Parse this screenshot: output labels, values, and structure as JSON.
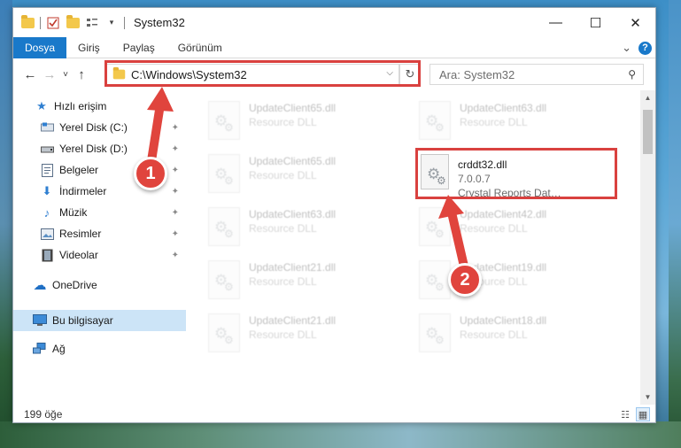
{
  "window": {
    "title": "System32",
    "controls": {
      "minimize": "—",
      "maximize": "☐",
      "close": "✕"
    }
  },
  "ribbon": {
    "tabs": [
      "Dosya",
      "Giriş",
      "Paylaş",
      "Görünüm"
    ],
    "collapse": "⌄",
    "help": "?"
  },
  "nav": {
    "back": "←",
    "forward": "→",
    "recent": "˅",
    "up": "↑",
    "address": "C:\\Windows\\System32",
    "address_dropdown": "⌵",
    "refresh": "↻",
    "search_placeholder": "Ara: System32",
    "search_icon": "⚲"
  },
  "sidebar": {
    "items": [
      {
        "label": "Hızlı erişim",
        "icon": "star-icon",
        "glyph": "★",
        "color": "#2f7fd1",
        "pinned": false
      },
      {
        "label": "Yerel Disk (C:)",
        "icon": "drive-icon",
        "glyph": "▭",
        "color": "#4a6b8a",
        "pinned": true
      },
      {
        "label": "Yerel Disk (D:)",
        "icon": "drive-icon",
        "glyph": "▬",
        "color": "#555555",
        "pinned": true
      },
      {
        "label": "Belgeler",
        "icon": "documents-icon",
        "glyph": "▤",
        "color": "#5a6f88",
        "pinned": true
      },
      {
        "label": "İndirmeler",
        "icon": "downloads-icon",
        "glyph": "⬇",
        "color": "#2f7fd1",
        "pinned": true
      },
      {
        "label": "Müzik",
        "icon": "music-icon",
        "glyph": "♪",
        "color": "#2f7fd1",
        "pinned": true
      },
      {
        "label": "Resimler",
        "icon": "pictures-icon",
        "glyph": "▣",
        "color": "#5a6f88",
        "pinned": true
      },
      {
        "label": "Videolar",
        "icon": "videos-icon",
        "glyph": "▦",
        "color": "#444444",
        "pinned": true
      },
      {
        "label": "OneDrive",
        "icon": "onedrive-icon",
        "glyph": "☁",
        "color": "#1f6fc4",
        "pinned": false
      },
      {
        "label": "Bu bilgisayar",
        "icon": "computer-icon",
        "glyph": "▭",
        "color": "#2f7fd1",
        "pinned": false
      },
      {
        "label": "Ağ",
        "icon": "network-icon",
        "glyph": "⊞",
        "color": "#2f7fd1",
        "pinned": false
      }
    ],
    "pin_glyph": "📌"
  },
  "files": [
    {
      "name": "UpdateClient65.dll",
      "sub": "Resource DLL",
      "faded": true
    },
    {
      "name": "UpdateClient63.dll",
      "sub": "Resource DLL",
      "faded": true
    },
    {
      "name": "UpdateClient65.dll",
      "sub": "Resource DLL",
      "faded": true
    },
    {
      "name": "crddt32.dll",
      "version": "7.0.0.7",
      "sub": "Crystal Reports Dat…",
      "faded": false
    },
    {
      "name": "UpdateClient63.dll",
      "sub": "Resource DLL",
      "faded": true
    },
    {
      "name": "UpdateClient42.dll",
      "sub": "Resource DLL",
      "faded": true
    },
    {
      "name": "UpdateClient21.dll",
      "sub": "Resource DLL",
      "faded": true
    },
    {
      "name": "UpdateClient19.dll",
      "sub": "Resource DLL",
      "faded": true
    },
    {
      "name": "UpdateClient21.dll",
      "sub": "Resource DLL",
      "faded": true
    },
    {
      "name": "UpdateClient18.dll",
      "sub": "Resource DLL",
      "faded": true
    }
  ],
  "status": {
    "count": "199 öğe",
    "view_details": "☷",
    "view_tiles": "▦"
  },
  "annotations": [
    {
      "label": "1"
    },
    {
      "label": "2"
    }
  ],
  "colors": {
    "accent": "#1979ca",
    "highlight": "#d9413f",
    "selected": "#cce4f7"
  }
}
